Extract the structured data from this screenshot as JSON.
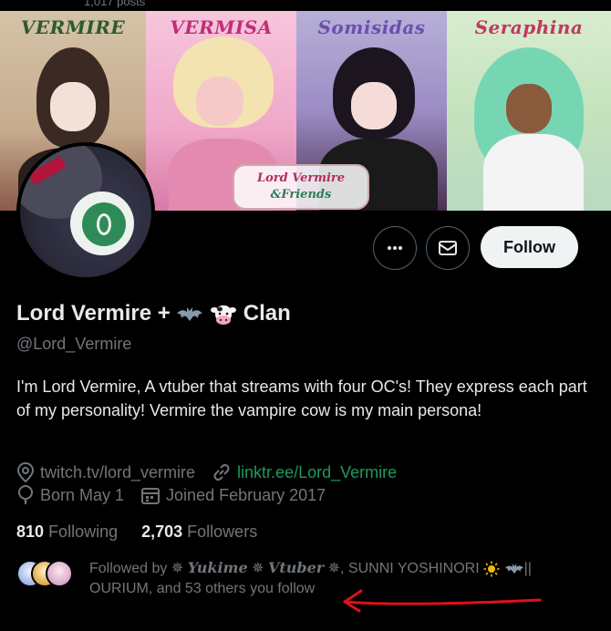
{
  "banner": {
    "top_text": "1,017 posts",
    "panels": [
      {
        "name": "VERMIRE"
      },
      {
        "name": "VERMISA"
      },
      {
        "name": "Somisidas"
      },
      {
        "name": "Seraphina"
      }
    ],
    "logo_line1": "Lord Vermire",
    "logo_line2": "&Friends"
  },
  "actions": {
    "more_icon": "more-dots-icon",
    "message_icon": "envelope-icon",
    "follow_label": "Follow"
  },
  "profile": {
    "display_name_prefix": "Lord Vermire +",
    "display_name_suffix": "Clan",
    "name_emojis": [
      "bat-icon",
      "cow-icon"
    ],
    "handle": "@Lord_Vermire",
    "bio": "I'm Lord Vermire, A vtuber that streams with four OC's! They express each part of my personality! Vermire the vampire cow is my main persona!",
    "location": "twitch.tv/lord_vermire",
    "website": "linktr.ee/Lord_Vermire",
    "birthday": "Born May 1",
    "joined": "Joined February 2017"
  },
  "stats": {
    "following_count": "810",
    "following_label": "Following",
    "followers_count": "2,703",
    "followers_label": "Followers"
  },
  "followed_by": {
    "prefix": "Followed by",
    "name1_decor_left": "✵",
    "name1": "𝓴𝓾𝓴𝓲𝓶𝓮",
    "name1_plain": "Yukime",
    "name1_mid": "✵",
    "name1_second": "Vtuber",
    "name1_decor_right": "✵",
    "separator": ",",
    "name2": "SUNNI YOSHINORI",
    "name2_suffix": "||",
    "name3": "OURIUM",
    "suffix": ", and 53 others you follow"
  },
  "colors": {
    "link_green": "#1d9b5a",
    "muted": "#71767b",
    "annotation_red": "#e0101a"
  }
}
